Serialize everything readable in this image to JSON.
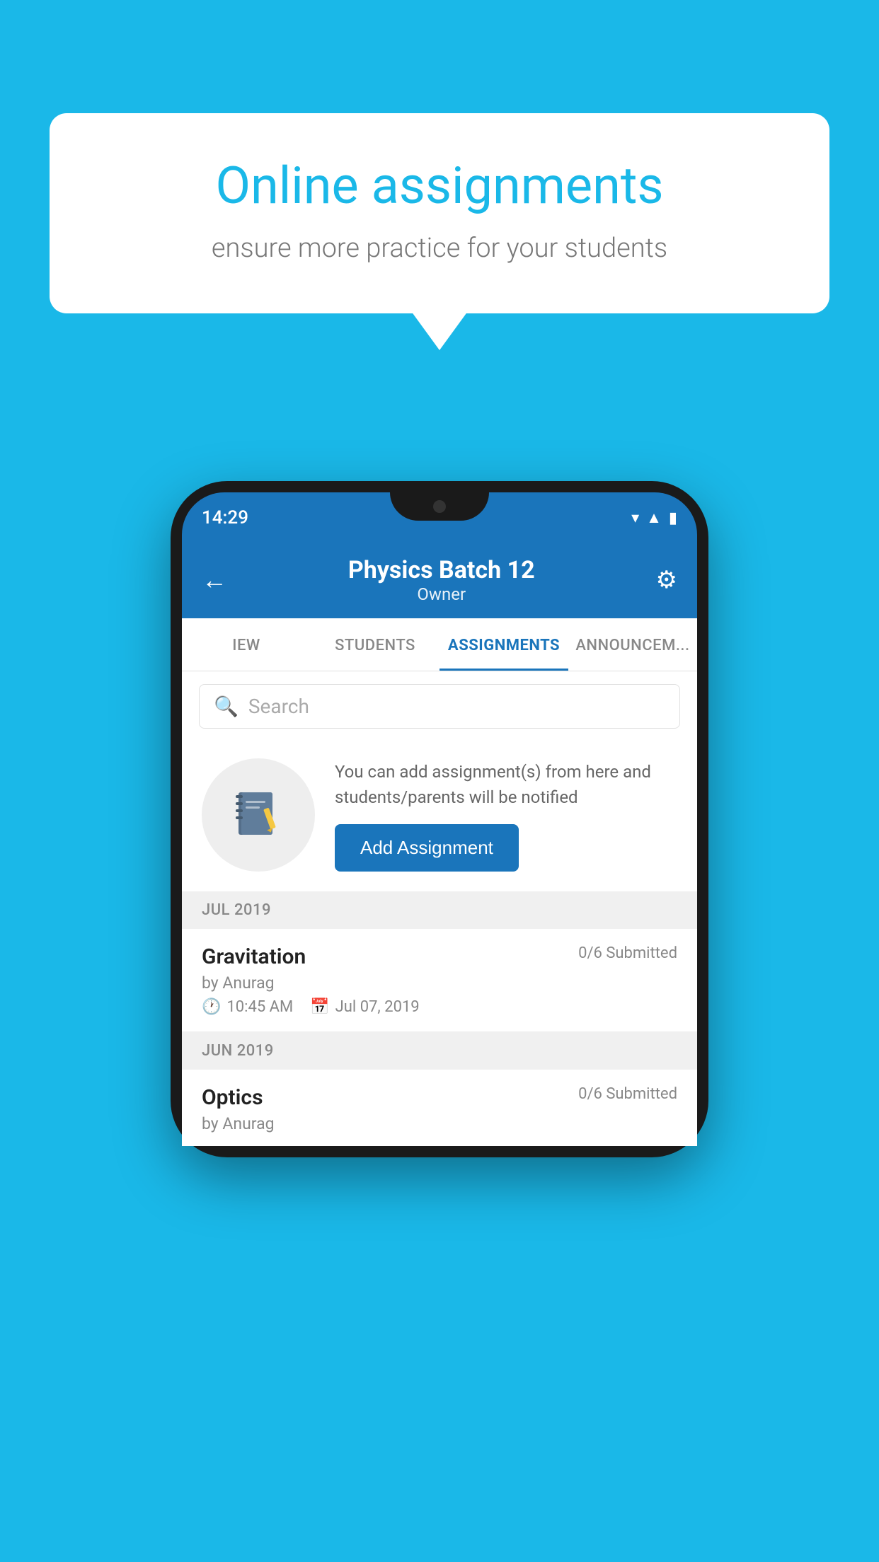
{
  "background": {
    "color": "#1ab8e8"
  },
  "speech_bubble": {
    "title": "Online assignments",
    "subtitle": "ensure more practice for your students"
  },
  "phone": {
    "status_bar": {
      "time": "14:29",
      "icons": [
        "wifi",
        "signal",
        "battery"
      ]
    },
    "header": {
      "back_label": "←",
      "title": "Physics Batch 12",
      "subtitle": "Owner",
      "gear_label": "⚙"
    },
    "tabs": [
      {
        "id": "iew",
        "label": "IEW",
        "active": false
      },
      {
        "id": "students",
        "label": "STUDENTS",
        "active": false
      },
      {
        "id": "assignments",
        "label": "ASSIGNMENTS",
        "active": true
      },
      {
        "id": "announcements",
        "label": "ANNOUNCEM...",
        "active": false
      }
    ],
    "search": {
      "placeholder": "Search"
    },
    "promo": {
      "text": "You can add assignment(s) from here and students/parents will be notified",
      "button_label": "Add Assignment"
    },
    "sections": [
      {
        "id": "jul-2019",
        "label": "JUL 2019",
        "assignments": [
          {
            "id": "gravitation",
            "name": "Gravitation",
            "submitted": "0/6 Submitted",
            "by": "by Anurag",
            "time": "10:45 AM",
            "date": "Jul 07, 2019"
          }
        ]
      },
      {
        "id": "jun-2019",
        "label": "JUN 2019",
        "assignments": [
          {
            "id": "optics",
            "name": "Optics",
            "submitted": "0/6 Submitted",
            "by": "by Anurag",
            "time": "",
            "date": ""
          }
        ]
      }
    ]
  }
}
